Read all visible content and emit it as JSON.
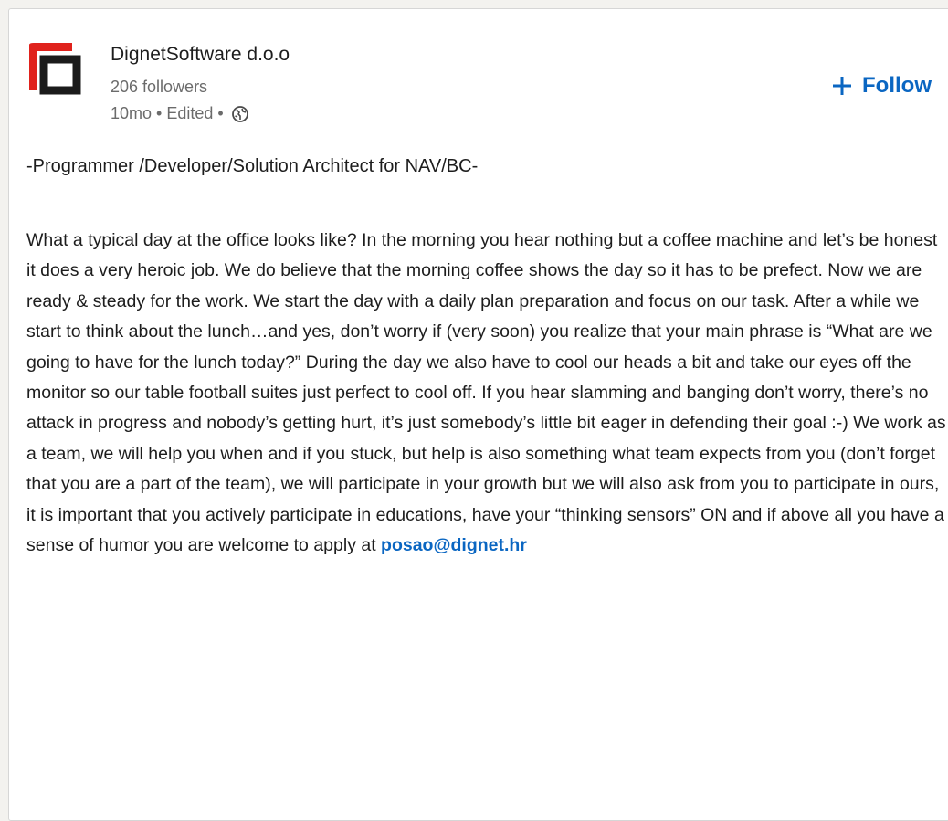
{
  "company": {
    "name": "DignetSoftware d.o.o",
    "followers": "206 followers",
    "time": "10mo",
    "edited": "Edited",
    "separator": "•",
    "logo_colors": {
      "accent": "#e0221c",
      "dark": "#1b1b1b"
    }
  },
  "follow_button": {
    "label": "Follow",
    "icon": "plus-icon",
    "color": "#0a66c2"
  },
  "post": {
    "title": "-Programmer /Developer/Solution Architect for NAV/BC-",
    "body": "What a typical day at the office looks like? In the morning you hear nothing but a coffee machine and let’s be honest it does a very heroic job. We do believe that the morning coffee shows the day so it has to be prefect. Now we are ready & steady for the work. We start the day with a daily plan preparation and focus on our task. After a while we start to think about the lunch…and yes, don’t worry if (very soon) you realize that your main phrase is “What are we going to have for the lunch today?” During the day we also have to cool our heads a bit and take our eyes off the monitor so our table football suites just perfect to cool off. If you hear slamming and banging don’t worry, there’s no attack in progress and nobody’s getting hurt, it’s just somebody’s little bit eager in defending their goal :-) We work as a team, we will help you when and if you stuck, but help is also something what team expects from you (don’t forget that you are a part of the team), we will participate in your growth but we will also ask from you to participate in ours, it is important that you actively participate in educations, have your “thinking sensors” ON and if above all you have a sense of humor you are welcome to apply at",
    "email": "posao@dignet.hr"
  },
  "icons": {
    "visibility": "globe-icon"
  }
}
